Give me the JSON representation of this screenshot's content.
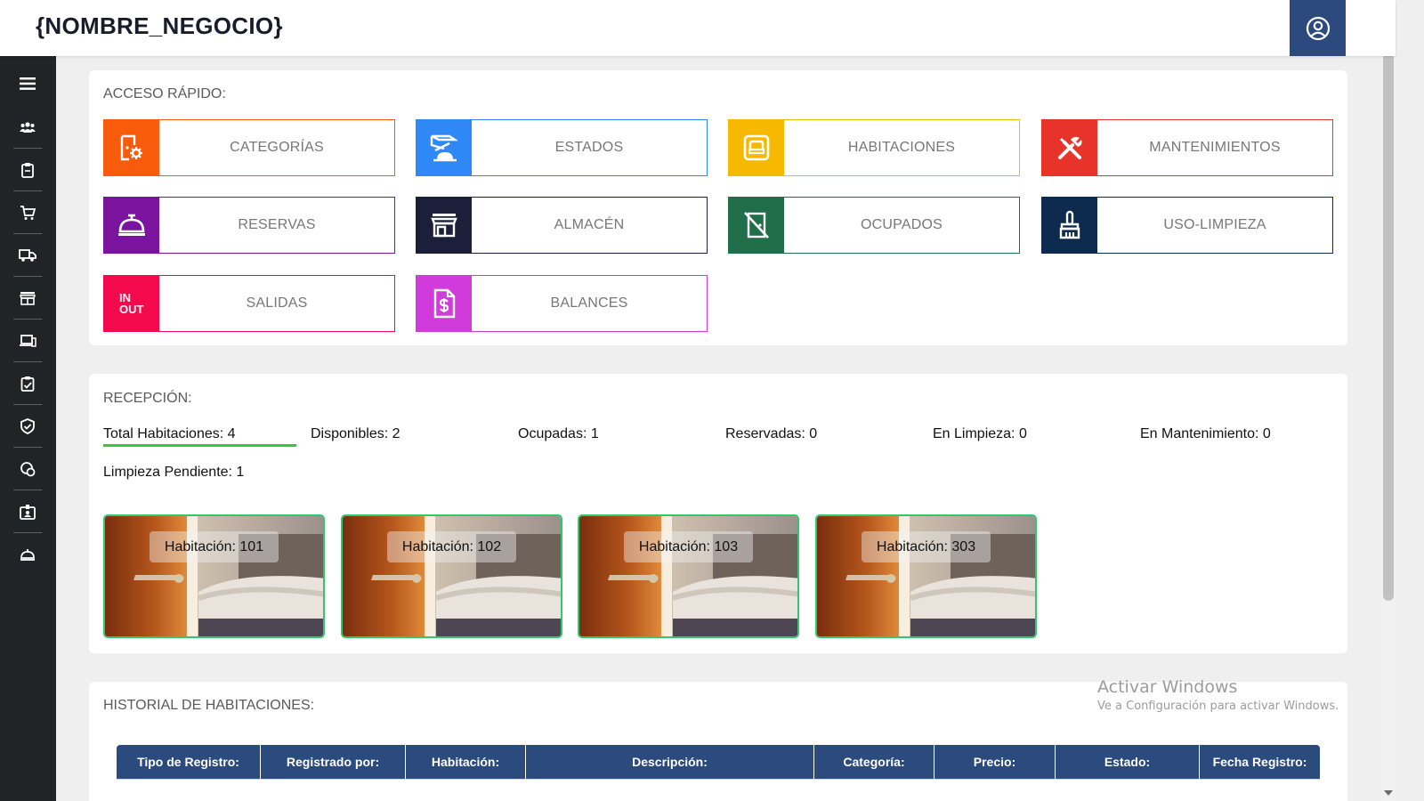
{
  "app": {
    "brand": "{NOMBRE_NEGOCIO}"
  },
  "header": {
    "user_icon": "user-circle-icon"
  },
  "sidebar": {
    "items": [
      {
        "icon": "menu-icon"
      },
      {
        "icon": "users-icon"
      },
      {
        "icon": "clipboard-icon"
      },
      {
        "icon": "cart-icon"
      },
      {
        "icon": "truck-icon"
      },
      {
        "icon": "store-icon"
      },
      {
        "icon": "devices-icon"
      },
      {
        "icon": "task-icon"
      },
      {
        "icon": "shield-icon"
      },
      {
        "icon": "coins-icon"
      },
      {
        "icon": "id-card-icon"
      },
      {
        "icon": "service-bell-icon"
      }
    ]
  },
  "quick_access": {
    "title": "ACCESO RÁPIDO:",
    "tiles": [
      {
        "label": "CATEGORÍAS",
        "color": "#f95b0c",
        "icon": "categories-icon"
      },
      {
        "label": "ESTADOS",
        "color": "#2f88f5",
        "icon": "status-icon"
      },
      {
        "label": "HABITACIONES",
        "color": "#f7b900",
        "icon": "room-icon"
      },
      {
        "label": "MANTENIMIENTOS",
        "color": "#e8332a",
        "icon": "tools-icon"
      },
      {
        "label": "RESERVAS",
        "color": "#7a149e",
        "icon": "service-bell-icon"
      },
      {
        "label": "ALMACÉN",
        "color": "#1c1f3a",
        "icon": "warehouse-icon"
      },
      {
        "label": "OCUPADOS",
        "color": "#216e4a",
        "icon": "occupied-icon"
      },
      {
        "label": "USO-LIMPIEZA",
        "color": "#0d2b4e",
        "icon": "broom-icon"
      },
      {
        "label": "SALIDAS",
        "color": "#f5094d",
        "icon": "in-out-icon",
        "icon_text": [
          "IN",
          "OUT"
        ]
      },
      {
        "label": "BALANCES",
        "color": "#d13bdc",
        "icon": "invoice-icon"
      }
    ]
  },
  "reception": {
    "title": "RECEPCIÓN:",
    "stats": [
      "Total Habitaciones: 4",
      "Disponibles: 2",
      "Ocupadas: 1",
      "Reservadas: 0",
      "En Limpieza: 0",
      "En Mantenimiento: 0",
      "Limpieza Pendiente: 1"
    ],
    "rooms": [
      {
        "label": "Habitación: 101"
      },
      {
        "label": "Habitación: 102"
      },
      {
        "label": "Habitación: 103"
      },
      {
        "label": "Habitación: 303"
      }
    ]
  },
  "history": {
    "title": "HISTORIAL DE HABITACIONES:",
    "columns": [
      "Tipo de Registro:",
      "Registrado por:",
      "Habitación:",
      "Descripción:",
      "Categoría:",
      "Precio:",
      "Estado:",
      "Fecha Registro:"
    ]
  },
  "watermark": {
    "line1": "Activar Windows",
    "line2": "Ve a Configuración para activar Windows."
  }
}
